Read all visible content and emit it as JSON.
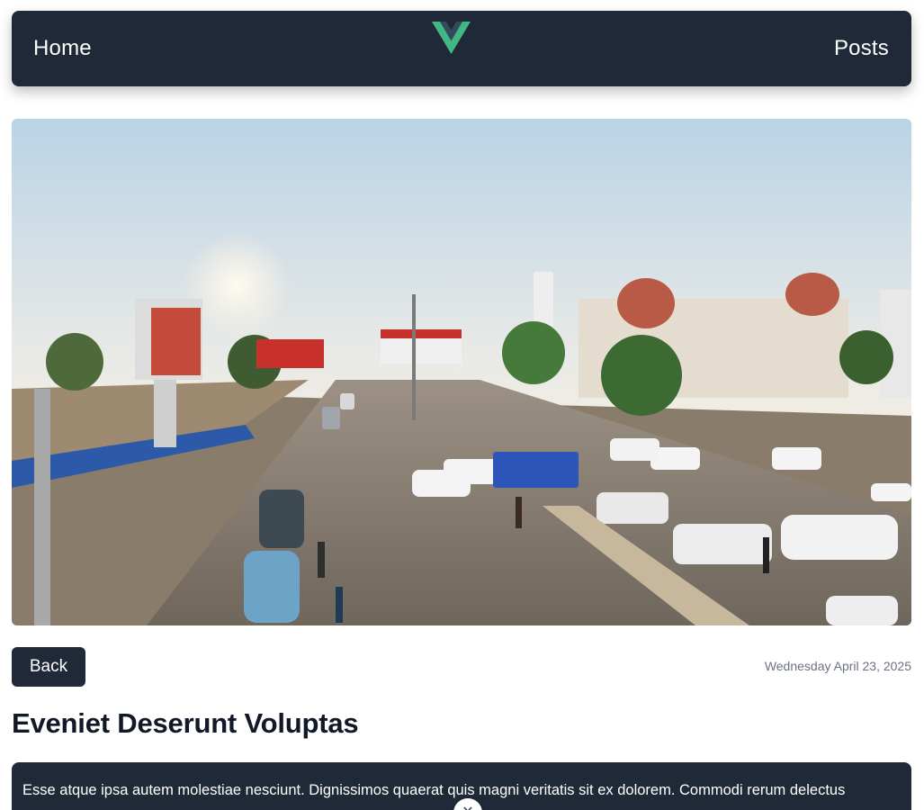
{
  "nav": {
    "home_label": "Home",
    "posts_label": "Posts",
    "logo_icon": "vue-logo-icon",
    "colors": {
      "background": "#1f2937",
      "logo_outer": "#41b883",
      "logo_inner": "#34495e"
    }
  },
  "hero": {
    "icon": "street-scene-image"
  },
  "post": {
    "back_label": "Back",
    "date": "Wednesday April 23, 2025",
    "title": "Eveniet Deserunt Voluptas",
    "body": "Esse atque ipsa autem molestiae nesciunt. Dignissimos quaerat quis magni veritatis sit ex dolorem. Commodi rerum delectus"
  },
  "overlay": {
    "close_glyph": "✕",
    "icon": "close-icon"
  }
}
